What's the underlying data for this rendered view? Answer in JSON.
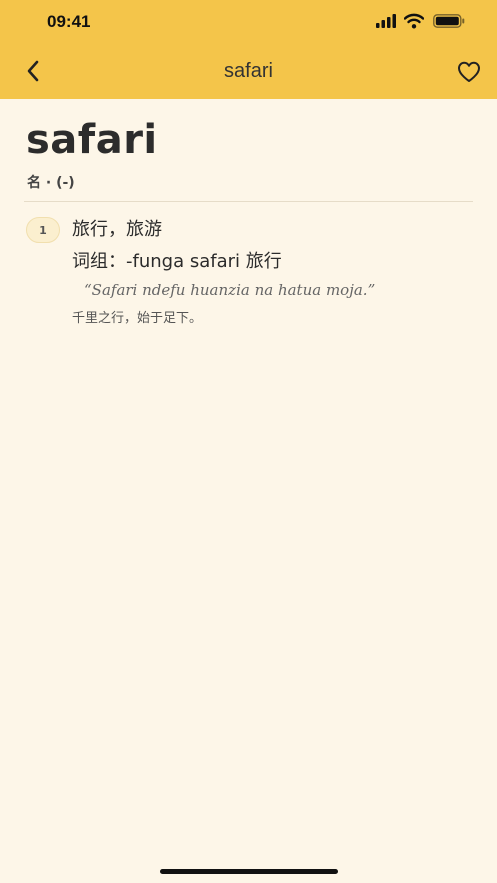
{
  "status_bar": {
    "time": "09:41"
  },
  "nav": {
    "title": "safari",
    "back_icon": "chevron-left-icon",
    "favorite_icon": "heart-outline-icon"
  },
  "entry": {
    "headword": "safari",
    "part_of_speech": "名 · (-)",
    "senses": [
      {
        "number": "1",
        "definition": "旅行，旅游",
        "phrase": "词组：-funga safari 旅行",
        "example": "“Safari ndefu huanzia na hatua moja.”",
        "example_translation": "千里之行，始于足下。"
      }
    ]
  },
  "colors": {
    "header_bg": "#f4c54a",
    "page_bg": "#fdf6e8",
    "badge_bg": "#fbefcf"
  }
}
